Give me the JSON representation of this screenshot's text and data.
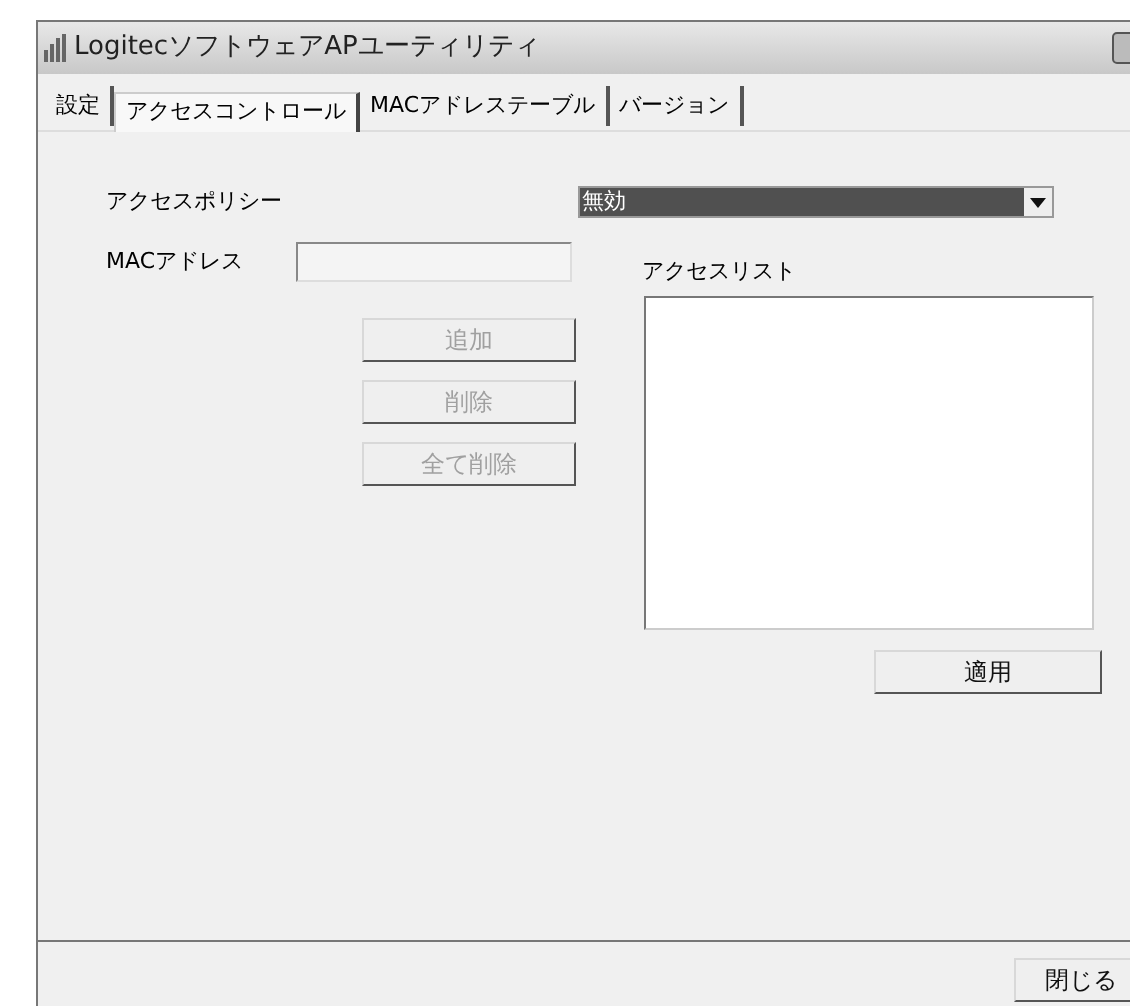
{
  "window": {
    "title": "LogitecソフトウェアAPユーティリティ"
  },
  "tabs": [
    {
      "label": "設定",
      "selected": false
    },
    {
      "label": "アクセスコントロール",
      "selected": true
    },
    {
      "label": "MACアドレステーブル",
      "selected": false
    },
    {
      "label": "バージョン",
      "selected": false
    }
  ],
  "access_policy": {
    "label": "アクセスポリシー",
    "value": "無効"
  },
  "mac_address": {
    "label": "MACアドレス"
  },
  "buttons": [
    {
      "label": "追加",
      "disabled": true
    },
    {
      "label": "削除",
      "disabled": true
    },
    {
      "label": "全て削除",
      "disabled": true
    }
  ],
  "access_list": {
    "label": "アクセスリスト"
  },
  "apply_button": {
    "label": "適用"
  },
  "close_button": {
    "label": "閉じる"
  }
}
